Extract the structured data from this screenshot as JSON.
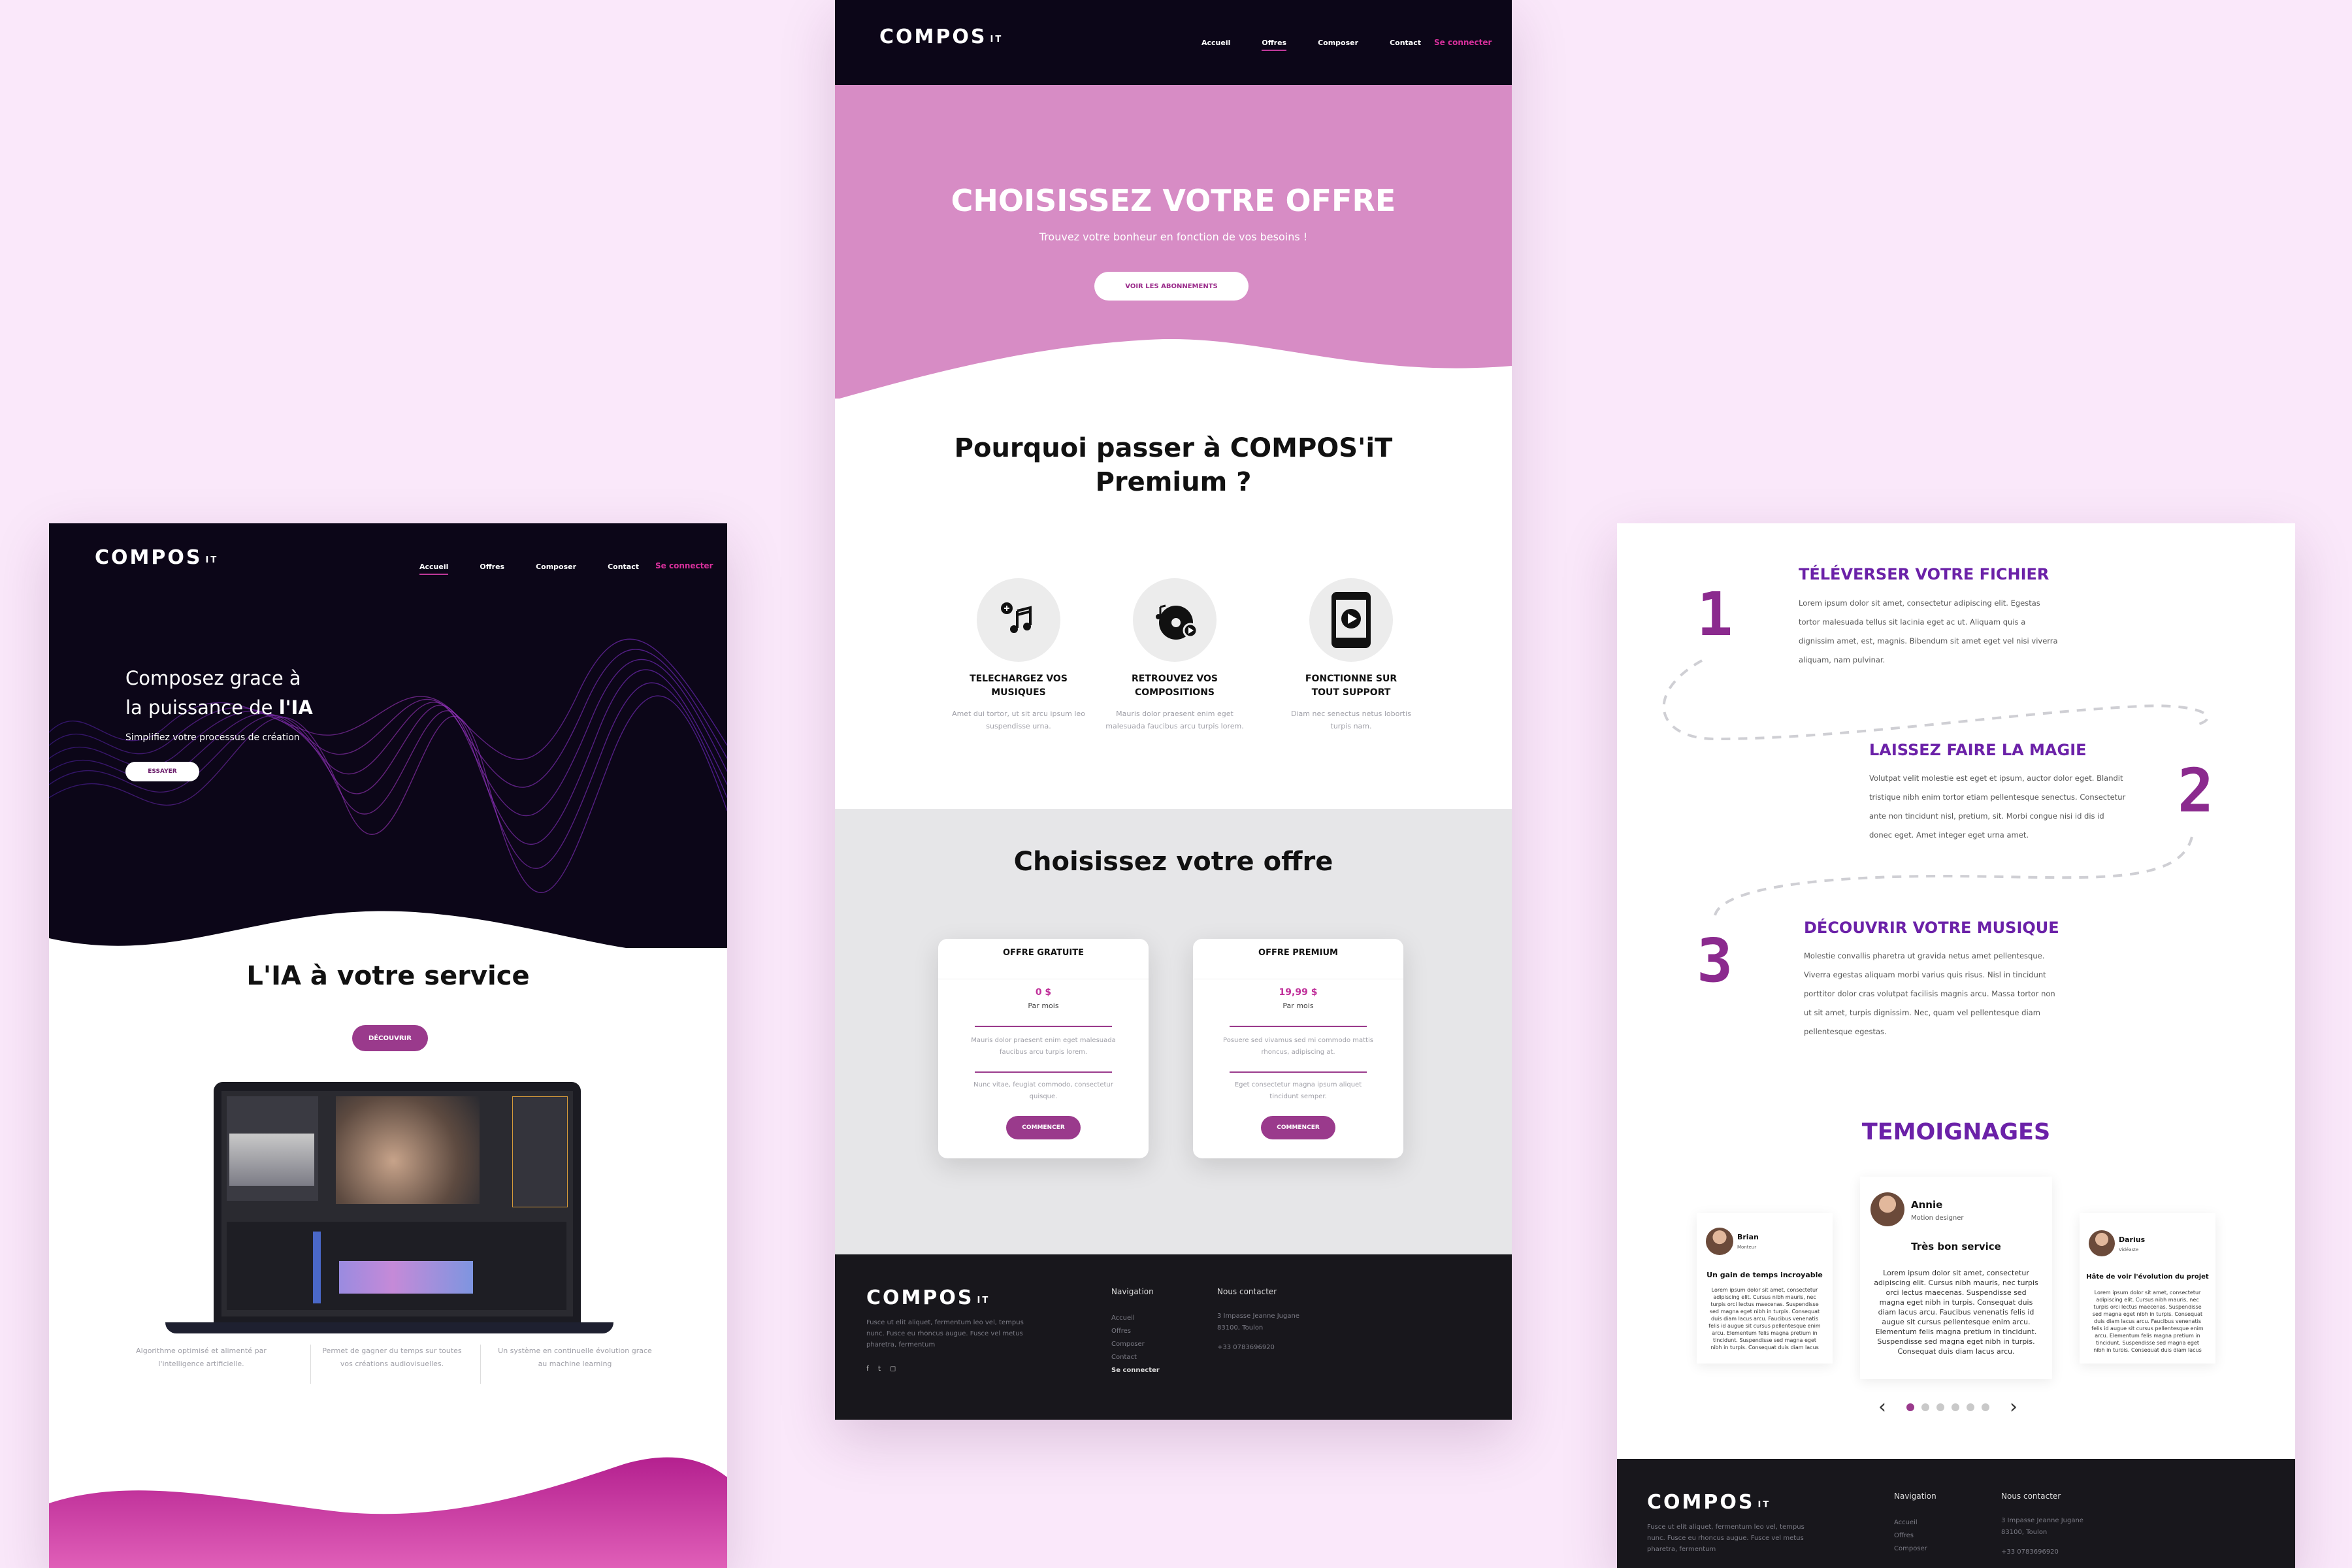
{
  "brand": {
    "logo_main": "COMPOS",
    "logo_sup": "IT"
  },
  "colors": {
    "background": "#fae8fa",
    "dark_nav": "#0c0618",
    "pink_hero": "#d78cc5",
    "accent": "#9a3a8c",
    "magenta": "#d8309c",
    "purple": "#6b21a8",
    "footer": "#18171c"
  },
  "nav": {
    "items": [
      "Accueil",
      "Offres",
      "Composer",
      "Contact"
    ],
    "login": "Se connecter"
  },
  "home": {
    "hero_line1": "Composez grace à",
    "hero_line2_pre": "la puissance de ",
    "hero_line2_bold": "l'IA",
    "hero_sub": "Simplifiez votre processus de création",
    "hero_cta": "ESSAYER",
    "section_title": "L'IA à votre service",
    "section_cta": "DÉCOUVRIR",
    "features": [
      {
        "text": "Algorithme optimisé et alimenté par l'intelligence artificielle."
      },
      {
        "text": "Permet de gagner du temps sur toutes vos créations audiovisuelles."
      },
      {
        "text": "Un système en continuelle évolution grace au machine learning"
      }
    ]
  },
  "offers": {
    "hero_title": "CHOISISSEZ VOTRE OFFRE",
    "hero_sub": "Trouvez votre bonheur en fonction de vos besoins !",
    "hero_cta": "VOIR LES ABONNEMENTS",
    "why_title_line1": "Pourquoi passer à COMPOS'iT",
    "why_title_line2": "Premium ?",
    "features": [
      {
        "icon": "music-note-icon",
        "title_line1": "TELECHARGEZ VOS",
        "title_line2": "MUSIQUES",
        "text": "Amet dui tortor, ut sit arcu ipsum leo suspendisse urna."
      },
      {
        "icon": "music-collection-icon",
        "title_line1": "RETROUVEZ VOS",
        "title_line2": "COMPOSITIONS",
        "text": "Mauris dolor praesent enim eget malesuada faucibus arcu turpis lorem."
      },
      {
        "icon": "device-play-icon",
        "title_line1": "FONCTIONNE SUR",
        "title_line2": "TOUT SUPPORT",
        "text": "Diam nec senectus netus lobortis turpis nam."
      }
    ],
    "plans_title": "Choisissez votre offre",
    "plans": [
      {
        "name": "OFFRE GRATUITE",
        "price": "0 $",
        "period": "Par mois",
        "desc1": "Mauris dolor praesent enim eget malesuada faucibus arcu turpis lorem.",
        "desc2": "Nunc vitae, feugiat commodo, consectetur quisque.",
        "cta": "COMMENCER"
      },
      {
        "name": "OFFRE PREMIUM",
        "price": "19,99 $",
        "period": "Par mois",
        "desc1": "Posuere sed vivamus sed mi commodo mattis rhoncus, adipiscing at.",
        "desc2": "Eget consectetur magna ipsum aliquet tincidunt semper.",
        "cta": "COMMENCER"
      }
    ]
  },
  "footer": {
    "about": "Fusce ut elit aliquet, fermentum leo vel, tempus nunc. Fusce eu rhoncus augue. Fusce vel metus pharetra, fermentum",
    "nav_title": "Navigation",
    "nav_items": [
      "Accueil",
      "Offres",
      "Composer",
      "Contact",
      "Se connecter"
    ],
    "contact_title": "Nous contacter",
    "address_line1": "3 Impasse Jeanne Jugane",
    "address_line2": "83100, Toulon",
    "phone": "+33 0783696920",
    "social": [
      "facebook-icon",
      "twitter-icon",
      "instagram-icon"
    ]
  },
  "steps": {
    "items": [
      {
        "number": "1",
        "title": "TÉLÉVERSER VOTRE FICHIER",
        "lines": [
          "Lorem ipsum dolor sit amet, consectetur adipiscing elit. Egestas",
          "tortor malesuada tellus sit lacinia eget ac ut. Aliquam quis a",
          "dignissim amet, est, magnis. Bibendum sit amet eget vel nisi viverra",
          "aliquam, nam pulvinar."
        ]
      },
      {
        "number": "2",
        "title": "LAISSEZ FAIRE LA MAGIE",
        "lines": [
          "Volutpat velit molestie est eget et ipsum, auctor dolor eget. Blandit",
          "tristique nibh enim tortor etiam pellentesque senectus. Consectetur",
          "ante non tincidunt nisl, pretium, sit. Morbi congue nisi id dis id",
          "donec eget. Amet integer eget urna amet."
        ]
      },
      {
        "number": "3",
        "title": "DÉCOUVRIR VOTRE MUSIQUE",
        "lines": [
          "Molestie convallis pharetra ut gravida netus amet pellentesque.",
          "Viverra egestas aliquam morbi varius quis risus. Nisl in tincidunt",
          "porttitor dolor cras volutpat facilisis magnis arcu. Massa tortor non",
          "ut sit amet, turpis dignissim. Nec, quam vel pellentesque diam",
          "pellentesque egestas."
        ]
      }
    ],
    "testimonials_title": "TEMOIGNAGES",
    "testimonials": [
      {
        "name": "Brian",
        "role": "Monteur",
        "headline": "Un gain de temps incroyable",
        "text": "Lorem ipsum dolor sit amet, consectetur adipiscing elit. Cursus nibh mauris, nec turpis orci lectus maecenas. Suspendisse sed magna eget nibh in turpis. Consequat duis diam lacus arcu. Faucibus venenatis felis id augue sit cursus pellentesque enim arcu. Elementum felis magna pretium in tincidunt. Suspendisse sed magna eget nibh in turpis. Consequat duis diam lacus arcu."
      },
      {
        "name": "Annie",
        "role": "Motion designer",
        "headline": "Très bon service",
        "text": "Lorem ipsum dolor sit amet, consectetur adipiscing elit. Cursus nibh mauris, nec turpis orci lectus maecenas. Suspendisse sed magna eget nibh in turpis. Consequat duis diam lacus arcu. Faucibus venenatis felis id augue sit cursus pellentesque enim arcu. Elementum felis magna pretium in tincidunt. Suspendisse sed magna eget nibh in turpis. Consequat duis diam lacus arcu."
      },
      {
        "name": "Darius",
        "role": "Vidéaste",
        "headline": "Hâte de voir l'évolution du projet",
        "text": "Lorem ipsum dolor sit amet, consectetur adipiscing elit. Cursus nibh mauris, nec turpis orci lectus maecenas. Suspendisse sed magna eget nibh in turpis. Consequat duis diam lacus arcu. Faucibus venenatis felis id augue sit cursus pellentesque enim arcu. Elementum felis magna pretium in tincidunt. Suspendisse sed magna eget nibh in turpis. Consequat duis diam lacus arcu."
      }
    ],
    "prev": "‹",
    "next": "›"
  }
}
